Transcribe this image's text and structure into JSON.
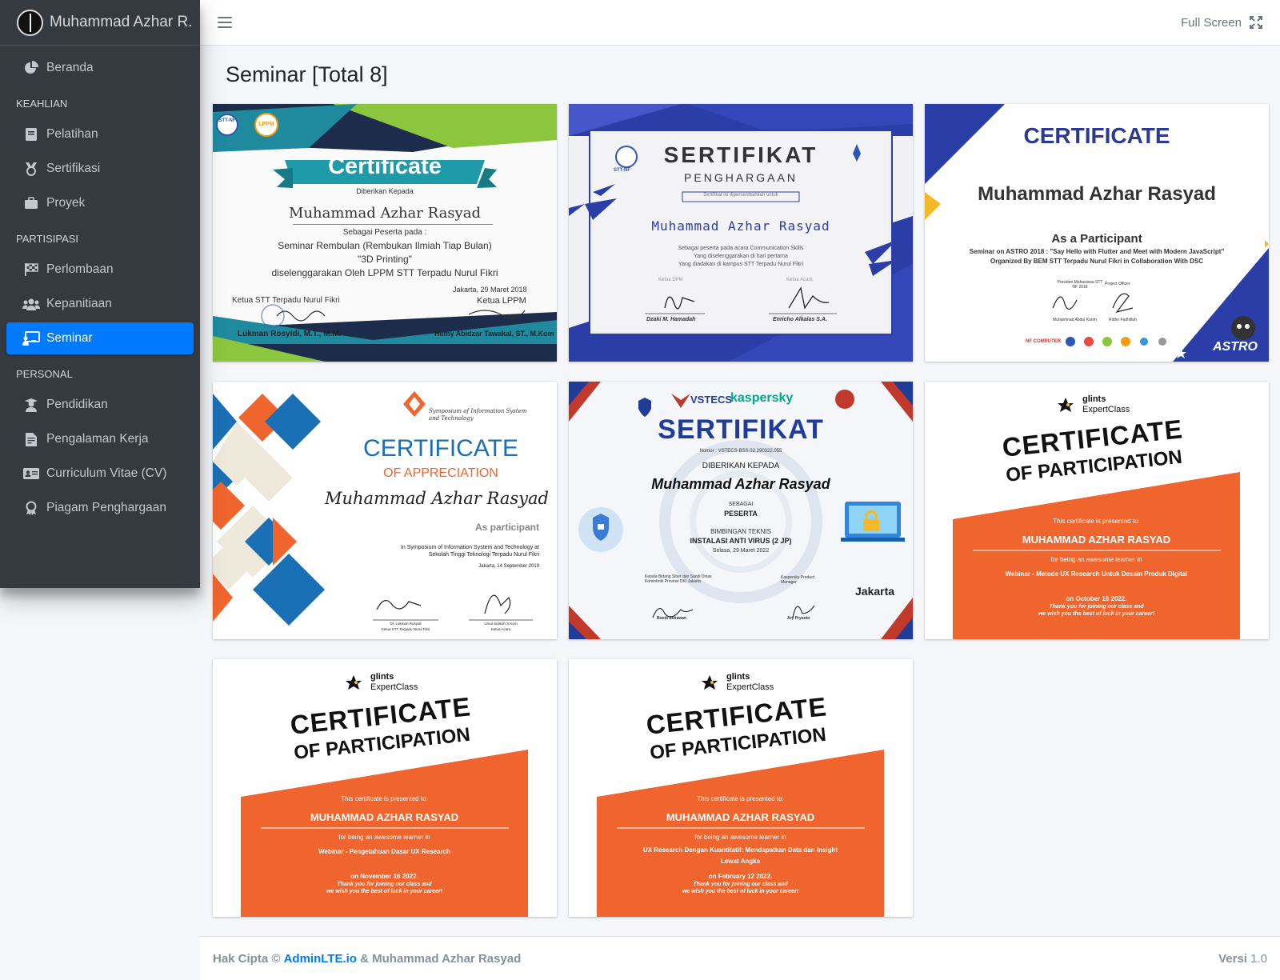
{
  "brand": {
    "name": "Muhammad Azhar R."
  },
  "sidebar": {
    "beranda": "Beranda",
    "header_keahlian": "KEAHLIAN",
    "pelatihan": "Pelatihan",
    "sertifikasi": "Sertifikasi",
    "proyek": "Proyek",
    "header_partisipasi": "PARTISIPASI",
    "perlombaan": "Perlombaan",
    "kepanitiaan": "Kepanitiaan",
    "seminar": "Seminar",
    "header_personal": "PERSONAL",
    "pendidikan": "Pendidikan",
    "pengalaman": "Pengalaman Kerja",
    "cv": "Curriculum Vitae (CV)",
    "piagam": "Piagam Penghargaan"
  },
  "topbar": {
    "fullscreen": "Full Screen"
  },
  "page": {
    "title": "Seminar [Total 8]"
  },
  "colors": {
    "primary": "#007bff",
    "sidebar": "#343a40",
    "orange": "#f0642d",
    "navy": "#2b3990"
  },
  "certificates": {
    "c1": {
      "title": "Certificate",
      "given_to": "Diberikan Kepada",
      "name": "Muhammad Azhar Rasyad",
      "as": "Sebagai Peserta pada :",
      "event": "Seminar Rembulan (Rembukan Ilmiah Tiap Bulan)",
      "topic": "\"3D Printing\"",
      "org": "diselenggarakan Oleh LPPM STT Terpadu Nurul Fikri",
      "date": "Jakarta, 29 Maret 2018",
      "left_role": "Ketua STT Terpadu Nurul Fikri",
      "right_role": "Ketua LPPM",
      "left_name": "Lukman Rosyidi, M.T., M.M.",
      "right_name": "Hilmy Abidzar Tawakal, ST., M.Kom",
      "logo1": "STT-NF",
      "logo2": "LPPM"
    },
    "c2": {
      "title": "SERTIFIKAT",
      "subtitle": "PENGHARGAAN",
      "given": "Sertifikat ini dipersembahkan untuk",
      "name": "Muhammad Azhar Rasyad",
      "line1": "Sebagai peserta pada acara Communication Skills",
      "line2": "Yang diselenggarakan di hari pertama",
      "line3": "Yang diadakan di kampus STT Terpadu Nurul Fikri",
      "left_role": "Ketua DPM",
      "right_role": "Ketua Acara",
      "left_name": "Dzaki M. Hamadah",
      "right_name": "Enricho Alkalas S.A.",
      "logo": "STT-NF"
    },
    "c3": {
      "title": "CERTIFICATE",
      "name": "Muhammad Azhar Rasyad",
      "as": "As a Participant",
      "line1": "Seminar on ASTRO 2018 : \"Say Hello with Flutter and Meet with Modern JavaScript\"",
      "line2": "Organized By BEM STT Terpadu Nurul Fikri in Collaboration With DSC",
      "left_role": "Presiden Mahasiswa STT NF 2018",
      "right_role": "Project Officer",
      "left_name": "Muhammad Abdul Karim",
      "right_name": "Ridho Fadhillah",
      "brand": "ASTRO",
      "sponsor": "NF COMPUTER"
    },
    "c4": {
      "org": "Symposium of Information System and Technology",
      "title": "CERTIFICATE",
      "subtitle": "OF APPRECIATION",
      "name": "Muhammad Azhar Rasyad",
      "as": "As participant",
      "line1": "In Symposium of Information System and Technology at",
      "line2": "Sekolah Tinggi Teknologi Terpadu Nurul Fikri",
      "date": "Jakarta, 14 September 2019",
      "left_name": "Dr. Lukman Rosyidi",
      "left_role": "Ketua STT Terpadu Nurul Fikri",
      "right_name": "Umul Sidikoh S.Kom",
      "right_role": "Ketua Acara"
    },
    "c5": {
      "brand1": "VSTECS",
      "brand2": "kaspersky",
      "title": "SERTIFIKAT",
      "nomor": "Nomor : VSTECS-BSS.02.290322.055",
      "given": "DIBERIKAN KEPADA",
      "name": "Muhammad Azhar Rasyad",
      "as_label": "SEBAGAI",
      "as": "PESERTA",
      "event_label": "BIMBINGAN TEKNIS",
      "event": "INSTALASI ANTI VIRUS (2 JP)",
      "date": "Selasa, 29 Maret 2022",
      "left_role": "Kepala Bidang Siber dan Sandi Dinas Kominfotik Provinsi DKI Jakarta",
      "left_name": "Boedi Setiawan",
      "right_role": "Kaspersky Product Manager",
      "right_name": "Ary Pryanto",
      "city": "Jakarta"
    },
    "glints": {
      "brand1": "glints",
      "brand2": "ExpertClass",
      "title1": "CERTIFICATE",
      "title2": "OF PARTICIPATION",
      "presented": "This certificate is presented to:",
      "name": "MUHAMMAD AZHAR RASYAD",
      "learner": "for being an awesome learner in",
      "thanks1": "Thank you for joining our class and",
      "thanks2": "we wish you the best of luck in your career!"
    },
    "c6": {
      "course": "Webinar - Metode UX Research Untuk Desain Produk Digital",
      "course2": "",
      "date": "on October 18 2022."
    },
    "c7": {
      "course": "Webinar - Pengetahuan Dasar UX Research",
      "course2": "",
      "date": "on November 16 2022."
    },
    "c8": {
      "course": "UX Research Dengan Kuantitatif: Mendapatkan Data dan Insight",
      "course2": "Lewat Angka",
      "date": "on February 12 2022."
    }
  },
  "footer": {
    "copyright": "Hak Cipta ©",
    "link": "AdminLTE.io",
    "owner": "& Muhammad Azhar Rasyad",
    "version_label": "Versi",
    "version": "1.0"
  }
}
